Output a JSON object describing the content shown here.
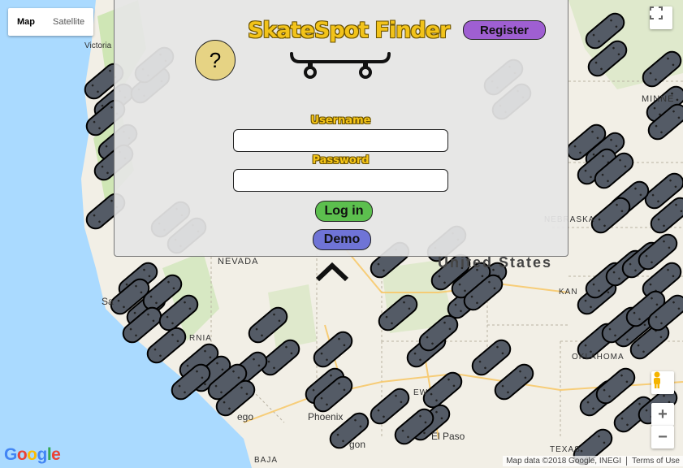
{
  "map": {
    "type_controls": {
      "map": "Map",
      "satellite": "Satellite"
    },
    "labels": {
      "victoria": "Victoria",
      "minnesota": "MINNE",
      "nevada": "NEVADA",
      "united_states": "United States",
      "nebraska": "NEBRASKA",
      "kansas": "KAN",
      "phoenix": "Phoenix",
      "el_paso": "El Paso",
      "texas": "TEXAS",
      "baja": "BAJA",
      "oklahoma": "OKLAHOMA",
      "sa": "Sa",
      "ego": "ego",
      "gon": "gon",
      "rnia": "RNIA",
      "new_mexico_frag": "EW"
    },
    "attribution": {
      "data": "Map data ©2018 Google, INEGI",
      "terms": "Terms of Use"
    },
    "google_logo": "Google",
    "colors": {
      "water": "#aadaff",
      "land": "#f2efe6",
      "park": "#cfe6b5",
      "marker": "#545b66"
    }
  },
  "panel": {
    "help_label": "?",
    "title": "SkateSpot Finder",
    "register_label": "Register",
    "username_label": "Username",
    "username_value": "",
    "password_label": "Password",
    "password_value": "",
    "login_label": "Log in",
    "demo_label": "Demo"
  }
}
